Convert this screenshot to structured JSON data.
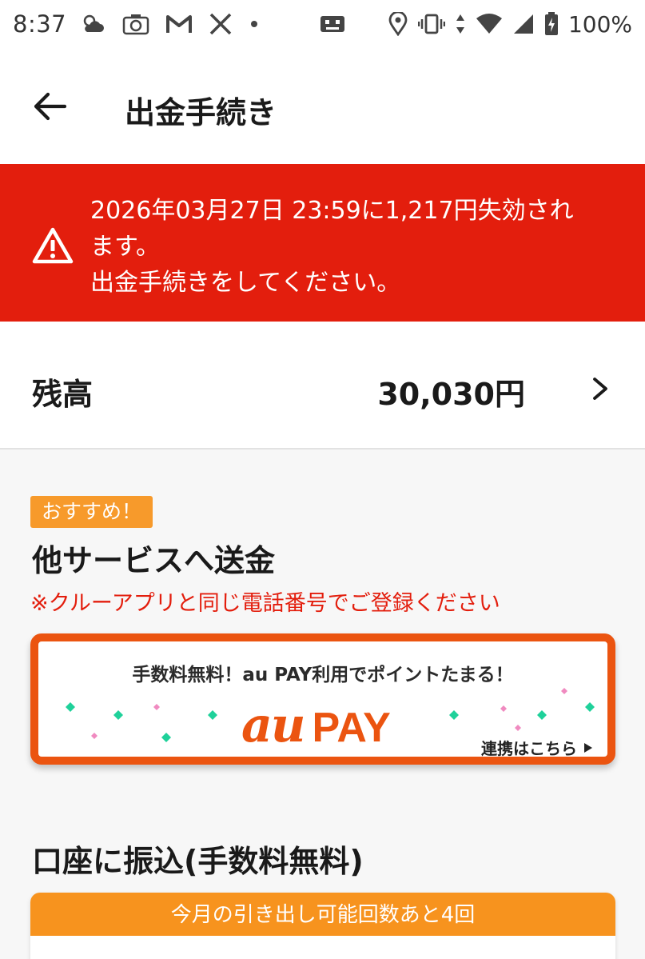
{
  "status_bar": {
    "time": "8:37",
    "battery": "100%",
    "left_icons": [
      "weather-icon",
      "camera-icon",
      "gmail-icon",
      "x-icon",
      "dot-icon"
    ],
    "right_icons": [
      "screen-record-icon",
      "location-icon",
      "vibrate-icon",
      "data-icon",
      "wifi-icon",
      "signal-icon",
      "battery-icon"
    ]
  },
  "header": {
    "title": "出金手続き"
  },
  "alert": {
    "line1": "2026年03月27日 23:59に1,217円失効され",
    "line2": "ます。",
    "line3": "出金手続きをしてください。",
    "color": "#e31e0d"
  },
  "balance": {
    "label": "残高",
    "value": "30,030円"
  },
  "transfer": {
    "badge": "おすすめ！",
    "title": "他サービスへ送金",
    "note": "※クルーアプリと同じ電話番号でご登録ください",
    "note_color": "#e31e0d"
  },
  "aupay": {
    "tagline": "手数料無料！au PAY利用でポイントたまる！",
    "logo_au": "au",
    "logo_pay": "PAY",
    "link": "連携はこちら",
    "brand_color": "#eb5410"
  },
  "bank": {
    "title": "口座に振込(手数料無料)",
    "header": "今月の引き出し可能回数あと4回",
    "header_color": "#f7931e"
  }
}
